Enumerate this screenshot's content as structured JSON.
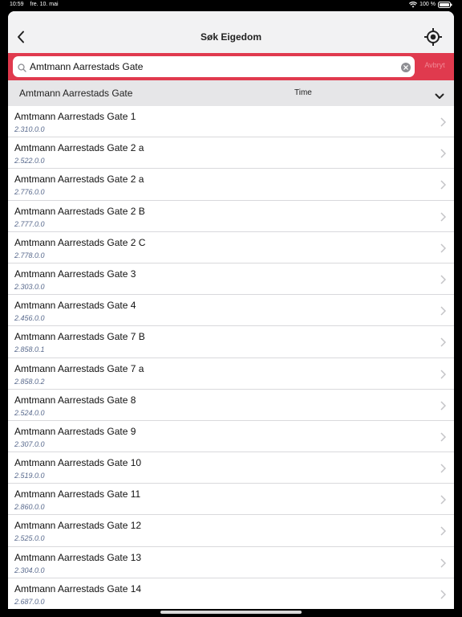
{
  "status_bar": {
    "time": "10:59",
    "date": "fre. 10. mai",
    "battery": "100 %"
  },
  "nav": {
    "title": "Søk Eigedom",
    "back_icon": "chevron-left-icon",
    "locate_icon": "crosshair-icon"
  },
  "search": {
    "value": "Amtmann Aarrestads Gate",
    "cancel_label": "Avbryt"
  },
  "group": {
    "title": "Amtmann Aarrestads Gate",
    "time_label": "Time"
  },
  "colors": {
    "accent": "#e03a4e",
    "subtitle": "#5a6b8e"
  },
  "results": [
    {
      "title": "Amtmann Aarrestads Gate 1",
      "subtitle": "2.310.0.0"
    },
    {
      "title": "Amtmann Aarrestads Gate 2 a",
      "subtitle": "2.522.0.0"
    },
    {
      "title": "Amtmann Aarrestads Gate 2 a",
      "subtitle": "2.776.0.0"
    },
    {
      "title": "Amtmann Aarrestads Gate 2 B",
      "subtitle": "2.777.0.0"
    },
    {
      "title": "Amtmann Aarrestads Gate 2 C",
      "subtitle": "2.778.0.0"
    },
    {
      "title": "Amtmann Aarrestads Gate 3",
      "subtitle": "2.303.0.0"
    },
    {
      "title": "Amtmann Aarrestads Gate 4",
      "subtitle": "2.456.0.0"
    },
    {
      "title": "Amtmann Aarrestads Gate 7 B",
      "subtitle": "2.858.0.1"
    },
    {
      "title": "Amtmann Aarrestads Gate 7 a",
      "subtitle": "2.858.0.2"
    },
    {
      "title": "Amtmann Aarrestads Gate 8",
      "subtitle": "2.524.0.0"
    },
    {
      "title": "Amtmann Aarrestads Gate 9",
      "subtitle": "2.307.0.0"
    },
    {
      "title": "Amtmann Aarrestads Gate 10",
      "subtitle": "2.519.0.0"
    },
    {
      "title": "Amtmann Aarrestads Gate 11",
      "subtitle": "2.860.0.0"
    },
    {
      "title": "Amtmann Aarrestads Gate 12",
      "subtitle": "2.525.0.0"
    },
    {
      "title": "Amtmann Aarrestads Gate 13",
      "subtitle": "2.304.0.0"
    },
    {
      "title": "Amtmann Aarrestads Gate 14",
      "subtitle": "2.687.0.0"
    }
  ]
}
